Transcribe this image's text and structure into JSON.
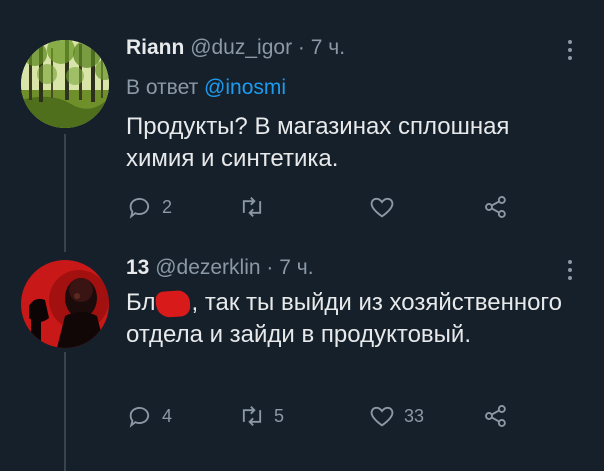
{
  "tweets": [
    {
      "display_name": "Riann",
      "handle": "@duz_igor",
      "separator": "·",
      "time": "7 ч.",
      "reply_prefix": "В ответ",
      "reply_mention": "@inosmi",
      "text": "Продукты? В магазинах сплошная химия и синтетика.",
      "replies": "2",
      "retweets": "",
      "likes": ""
    },
    {
      "display_name": "13",
      "handle": "@dezerklin",
      "separator": "·",
      "time": "7 ч.",
      "text_before_censor": "Бл",
      "text_after_censor": ", так ты выйди из хозяйственного отдела и зайди в продуктовый.",
      "replies": "4",
      "retweets": "5",
      "likes": "33"
    }
  ],
  "icons": {
    "reply": "reply-icon",
    "retweet": "retweet-icon",
    "like": "heart-icon",
    "share": "share-icon",
    "more": "more-icon"
  },
  "colors": {
    "background": "#15202b",
    "text": "#e7e9ea",
    "muted": "#8b98a5",
    "link": "#1d9bf0",
    "censor": "#d81a1a"
  }
}
